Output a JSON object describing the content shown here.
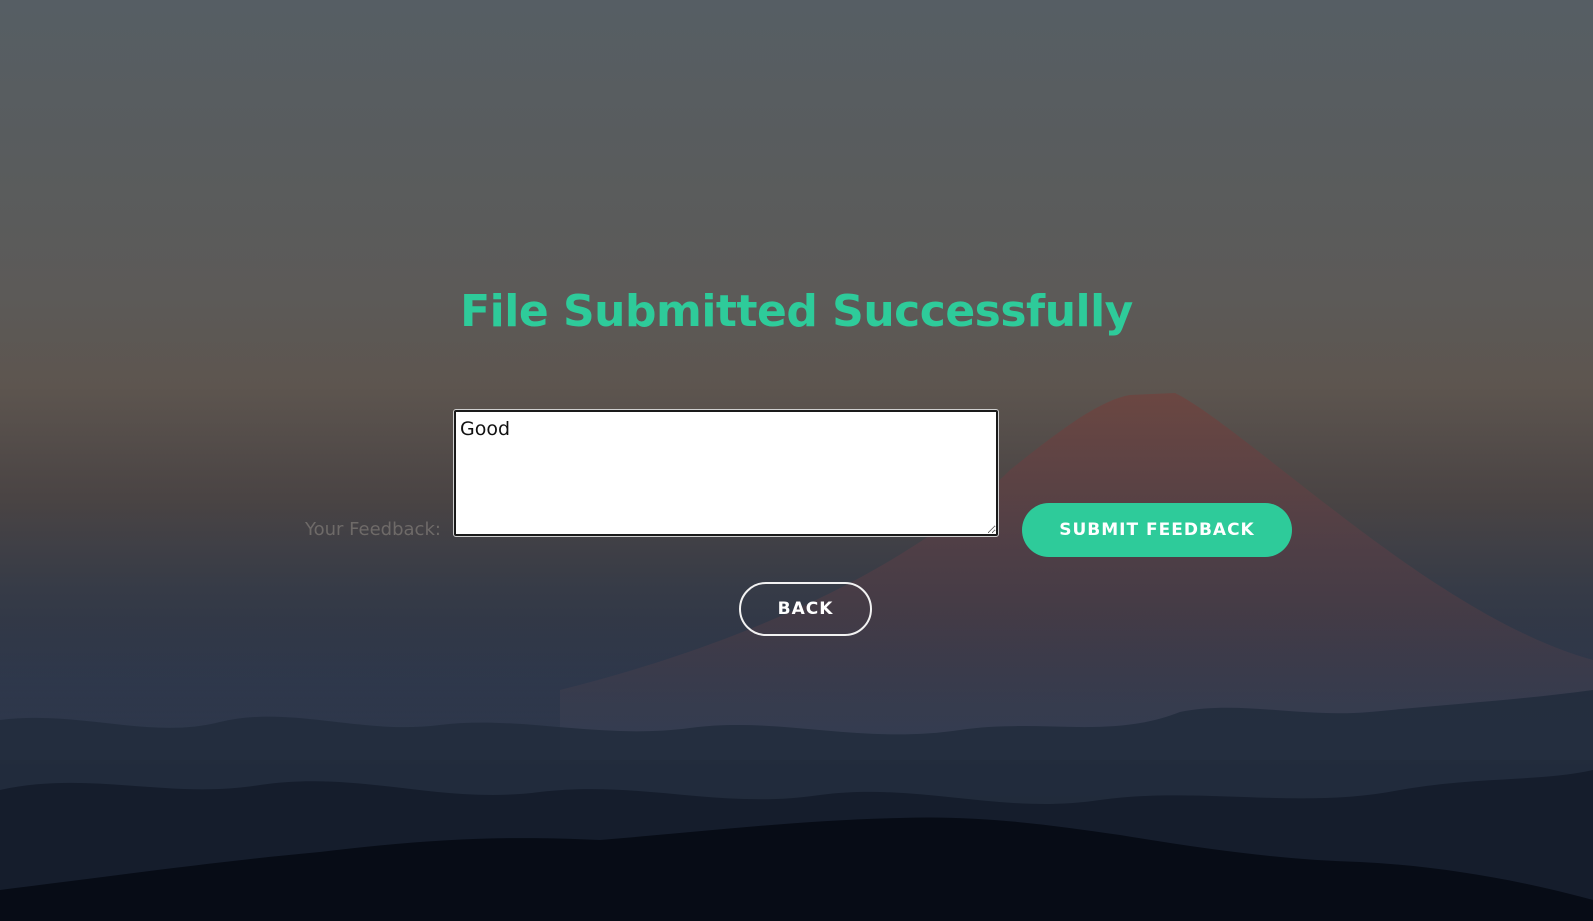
{
  "page": {
    "heading": "File Submitted Successfully"
  },
  "feedback": {
    "label": "Your Feedback:",
    "value": "Good"
  },
  "buttons": {
    "submit_label": "SUBMIT FEEDBACK",
    "back_label": "BACK"
  },
  "colors": {
    "accent": "#2ecb9a",
    "label_text": "#6e6a68"
  }
}
